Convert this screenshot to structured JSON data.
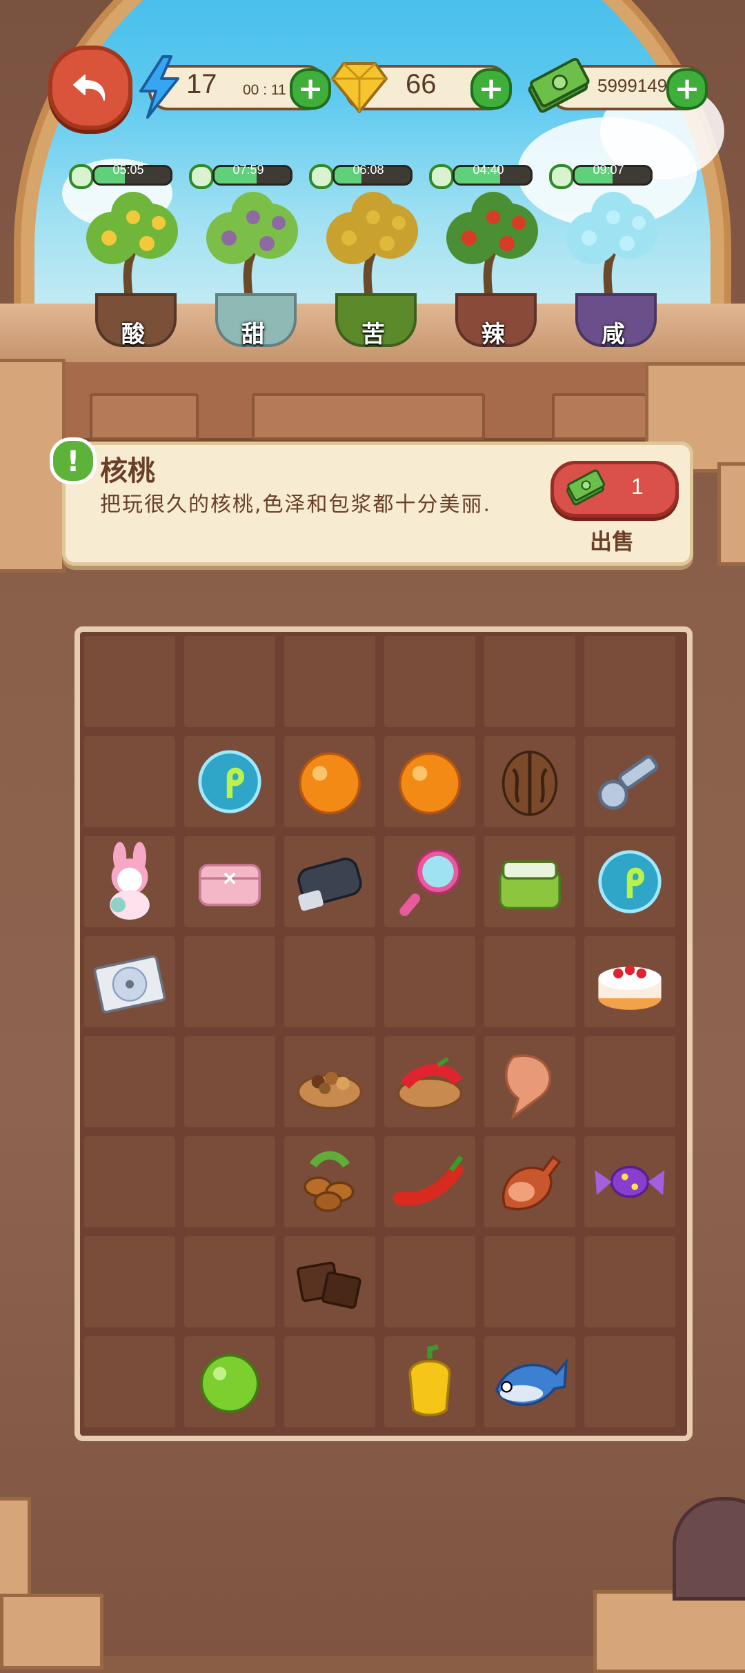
{
  "resources": {
    "energy": "17",
    "energy_timer": "00 : 11",
    "gems": "66",
    "cash": "5999149"
  },
  "plants": [
    {
      "label": "酸",
      "timer": "05:05",
      "fill": 0.4,
      "pot": "#7a5038",
      "leaf": "#6fb63a",
      "fruit": "#f2c93a",
      "icon": "lemon-tree-icon"
    },
    {
      "label": "甜",
      "timer": "07:59",
      "fill": 0.55,
      "pot": "#8fb9b5",
      "leaf": "#7bbf49",
      "fruit": "#8e6aa3",
      "icon": "sugarcane-icon"
    },
    {
      "label": "苦",
      "timer": "06:08",
      "fill": 0.35,
      "pot": "#5c8a2a",
      "leaf": "#c8a12e",
      "fruit": "#e0b93a",
      "icon": "bitter-plant-icon"
    },
    {
      "label": "辣",
      "timer": "04:40",
      "fill": 0.6,
      "pot": "#8a4a3a",
      "leaf": "#4b8f34",
      "fruit": "#d93b26",
      "icon": "pepper-plant-icon"
    },
    {
      "label": "咸",
      "timer": "09:07",
      "fill": 0.5,
      "pot": "#6a4f8a",
      "leaf": "#9fe3f2",
      "fruit": "#bdf0fb",
      "icon": "salt-crystal-icon"
    }
  ],
  "item_info": {
    "name": "核桃",
    "description": "把玩很久的核桃,色泽和包浆都十分美丽.",
    "price": "1",
    "sell_label": "出售"
  },
  "grid": {
    "cols": 6,
    "rows": 8,
    "items": [
      {
        "row": 1,
        "col": 1,
        "icon": "seed-bubble-icon"
      },
      {
        "row": 1,
        "col": 2,
        "icon": "orange-icon"
      },
      {
        "row": 1,
        "col": 3,
        "icon": "orange-icon"
      },
      {
        "row": 1,
        "col": 4,
        "icon": "walnut-icon"
      },
      {
        "row": 1,
        "col": 5,
        "icon": "key-icon"
      },
      {
        "row": 2,
        "col": 0,
        "icon": "plush-bunny-icon"
      },
      {
        "row": 2,
        "col": 1,
        "icon": "pink-wallet-icon"
      },
      {
        "row": 2,
        "col": 2,
        "icon": "car-key-fob-icon"
      },
      {
        "row": 2,
        "col": 3,
        "icon": "hand-mirror-icon"
      },
      {
        "row": 2,
        "col": 4,
        "icon": "lunch-box-icon"
      },
      {
        "row": 2,
        "col": 5,
        "icon": "seed-bubble-icon"
      },
      {
        "row": 3,
        "col": 0,
        "icon": "cd-case-icon"
      },
      {
        "row": 3,
        "col": 5,
        "icon": "strawberry-cake-icon"
      },
      {
        "row": 4,
        "col": 2,
        "icon": "mixed-nuts-bowl-icon"
      },
      {
        "row": 4,
        "col": 3,
        "icon": "chili-bowl-icon"
      },
      {
        "row": 4,
        "col": 4,
        "icon": "dried-fish-icon"
      },
      {
        "row": 5,
        "col": 2,
        "icon": "coffee-beans-icon"
      },
      {
        "row": 5,
        "col": 3,
        "icon": "chili-pepper-icon"
      },
      {
        "row": 5,
        "col": 4,
        "icon": "ham-leg-icon"
      },
      {
        "row": 5,
        "col": 5,
        "icon": "candy-icon"
      },
      {
        "row": 6,
        "col": 2,
        "icon": "chocolate-icon"
      },
      {
        "row": 7,
        "col": 1,
        "icon": "lime-icon"
      },
      {
        "row": 7,
        "col": 3,
        "icon": "yellow-pepper-icon"
      },
      {
        "row": 7,
        "col": 4,
        "icon": "fish-icon"
      }
    ]
  }
}
